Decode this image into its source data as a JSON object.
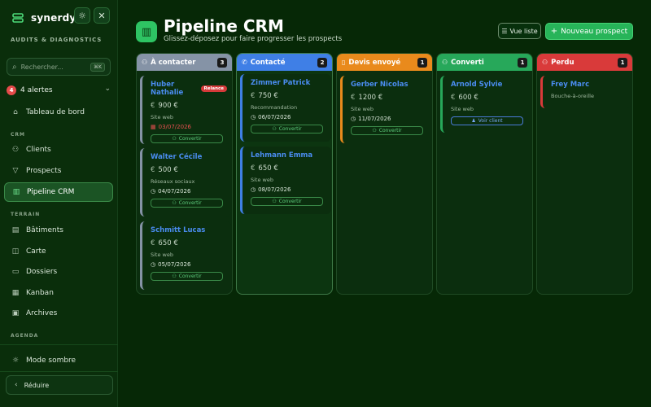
{
  "app": {
    "name": "synerdys",
    "subtitle": "AUDITS & DIAGNOSTICS"
  },
  "header_icons": {
    "theme": "sun-icon",
    "close": "close-icon"
  },
  "search": {
    "placeholder": "Rechercher...",
    "shortcut": "⌘K"
  },
  "alerts": {
    "count": "4",
    "label": "4 alertes"
  },
  "nav": {
    "dashboard": "Tableau de bord",
    "section_crm": "CRM",
    "clients": "Clients",
    "prospects": "Prospects",
    "pipeline": "Pipeline CRM",
    "section_terrain": "TERRAIN",
    "batiments": "Bâtiments",
    "carte": "Carte",
    "dossiers": "Dossiers",
    "kanban": "Kanban",
    "archives": "Archives",
    "section_agenda": "AGENDA",
    "dark_mode": "Mode sombre",
    "reduce": "Réduire"
  },
  "page": {
    "title": "Pipeline CRM",
    "subtitle": "Glissez-déposez pour faire progresser les prospects",
    "list_view": "Vue liste",
    "new_prospect": "Nouveau prospect"
  },
  "colors": {
    "a_contacter": "#8593a6",
    "contacte": "#3f7fe6",
    "devis": "#e98a1c",
    "converti": "#27a85a",
    "perdu": "#d93a3a",
    "accent": "#27b459"
  },
  "columns": [
    {
      "title": "À contacter",
      "count": "3",
      "cards": [
        {
          "name": "Huber Nathalie",
          "flag": "Relance",
          "amount": "900 €",
          "source": "Site web",
          "date": "03/07/2026",
          "action": "Convertir"
        },
        {
          "name": "Walter Cécile",
          "amount": "500 €",
          "source": "Réseaux sociaux",
          "date": "04/07/2026",
          "action": "Convertir"
        },
        {
          "name": "Schmitt Lucas",
          "amount": "650 €",
          "source": "Site web",
          "date": "05/07/2026",
          "action": "Convertir"
        }
      ]
    },
    {
      "title": "Contacté",
      "count": "2",
      "cards": [
        {
          "name": "Zimmer Patrick",
          "amount": "750 €",
          "source": "Recommandation",
          "date": "06/07/2026",
          "action": "Convertir"
        },
        {
          "name": "Lehmann Emma",
          "amount": "650 €",
          "source": "Site web",
          "date": "08/07/2026",
          "action": "Convertir"
        }
      ]
    },
    {
      "title": "Devis envoyé",
      "count": "1",
      "cards": [
        {
          "name": "Gerber Nicolas",
          "amount": "1200 €",
          "source": "Site web",
          "date": "11/07/2026",
          "action": "Convertir"
        }
      ]
    },
    {
      "title": "Converti",
      "count": "1",
      "cards": [
        {
          "name": "Arnold Sylvie",
          "amount": "600 €",
          "source": "Site web",
          "action": "Voir client"
        }
      ]
    },
    {
      "title": "Perdu",
      "count": "1",
      "cards": [
        {
          "name": "Frey Marc",
          "source": "Bouche-à-oreille"
        }
      ]
    }
  ]
}
